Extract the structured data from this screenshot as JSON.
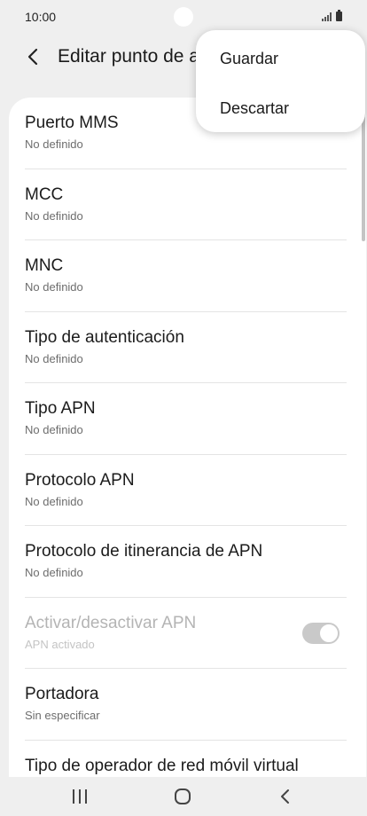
{
  "status_bar": {
    "time": "10:00"
  },
  "app_bar": {
    "title": "Editar punto de acceso"
  },
  "menu": {
    "items": [
      "Guardar",
      "Descartar"
    ]
  },
  "list": [
    {
      "title": "Puerto MMS",
      "subtitle": "No definido"
    },
    {
      "title": "MCC",
      "subtitle": "No definido"
    },
    {
      "title": "MNC",
      "subtitle": "No definido"
    },
    {
      "title": "Tipo de autenticación",
      "subtitle": "No definido"
    },
    {
      "title": "Tipo APN",
      "subtitle": "No definido"
    },
    {
      "title": "Protocolo APN",
      "subtitle": "No definido"
    },
    {
      "title": "Protocolo de itinerancia de APN",
      "subtitle": "No definido"
    },
    {
      "title": "Activar/desactivar APN",
      "subtitle": "APN activado",
      "toggle_on": true,
      "disabled": true
    },
    {
      "title": "Portadora",
      "subtitle": "Sin especificar"
    },
    {
      "title": "Tipo de operador de red móvil virtual",
      "subtitle": ""
    }
  ]
}
